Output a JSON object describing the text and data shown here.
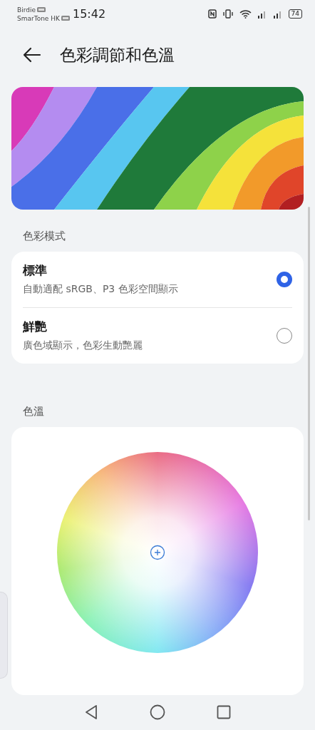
{
  "status_bar": {
    "carriers": [
      {
        "name": "Birdie"
      },
      {
        "name": "SmarTone HK"
      }
    ],
    "time": "15:42",
    "battery": "74"
  },
  "header": {
    "title": "色彩調節和色溫"
  },
  "color_mode": {
    "heading": "色彩模式",
    "options": [
      {
        "title": "標準",
        "description": "自動適配 sRGB、P3 色彩空間顯示",
        "selected": true
      },
      {
        "title": "鮮艷",
        "description": "廣色域顯示，色彩生動艷麗",
        "selected": false
      }
    ]
  },
  "color_temperature": {
    "heading": "色溫"
  }
}
